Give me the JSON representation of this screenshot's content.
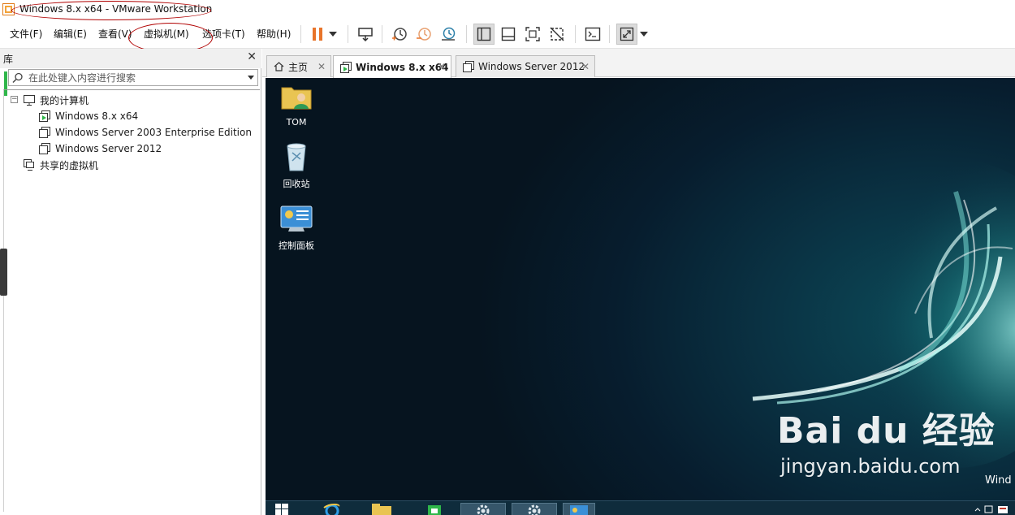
{
  "window": {
    "title": "Windows 8.x x64 - VMware Workstation"
  },
  "menu": [
    "文件(F)",
    "编辑(E)",
    "查看(V)",
    "虚拟机(M)",
    "选项卡(T)",
    "帮助(H)"
  ],
  "library": {
    "title": "库",
    "search_placeholder": "在此处键入内容进行搜索",
    "tree": {
      "root": "我的计算机",
      "vms": [
        "Windows 8.x x64",
        "Windows Server 2003 Enterprise Edition",
        "Windows Server 2012"
      ],
      "shared": "共享的虚拟机"
    }
  },
  "tabs": [
    "主页",
    "Windows 8.x x64",
    "Windows Server 2012"
  ],
  "desktop": {
    "icons": [
      "TOM",
      "回收站",
      "控制面板"
    ],
    "corner_text": "Wind"
  },
  "watermark": {
    "logo": "Bai du 经验",
    "url": "jingyan.baidu.com"
  },
  "colors": {
    "annotation": "#b00000",
    "pause_accent": "#e8742a",
    "running_green": "#2fb64a",
    "desktop_bg": "#071d2e"
  },
  "icons": [
    "vmware-app-icon",
    "pause-icon",
    "dropdown-icon",
    "send-keys-icon",
    "snapshot-icon",
    "revert-snapshot-icon",
    "snapshot-manager-icon",
    "library-view-icon",
    "thumbnail-bar-icon",
    "fullscreen-icon",
    "unity-icon",
    "console-icon",
    "stretch-icon",
    "close-icon",
    "search-icon",
    "computer-icon",
    "vm-icon",
    "shared-vm-icon",
    "home-icon"
  ]
}
